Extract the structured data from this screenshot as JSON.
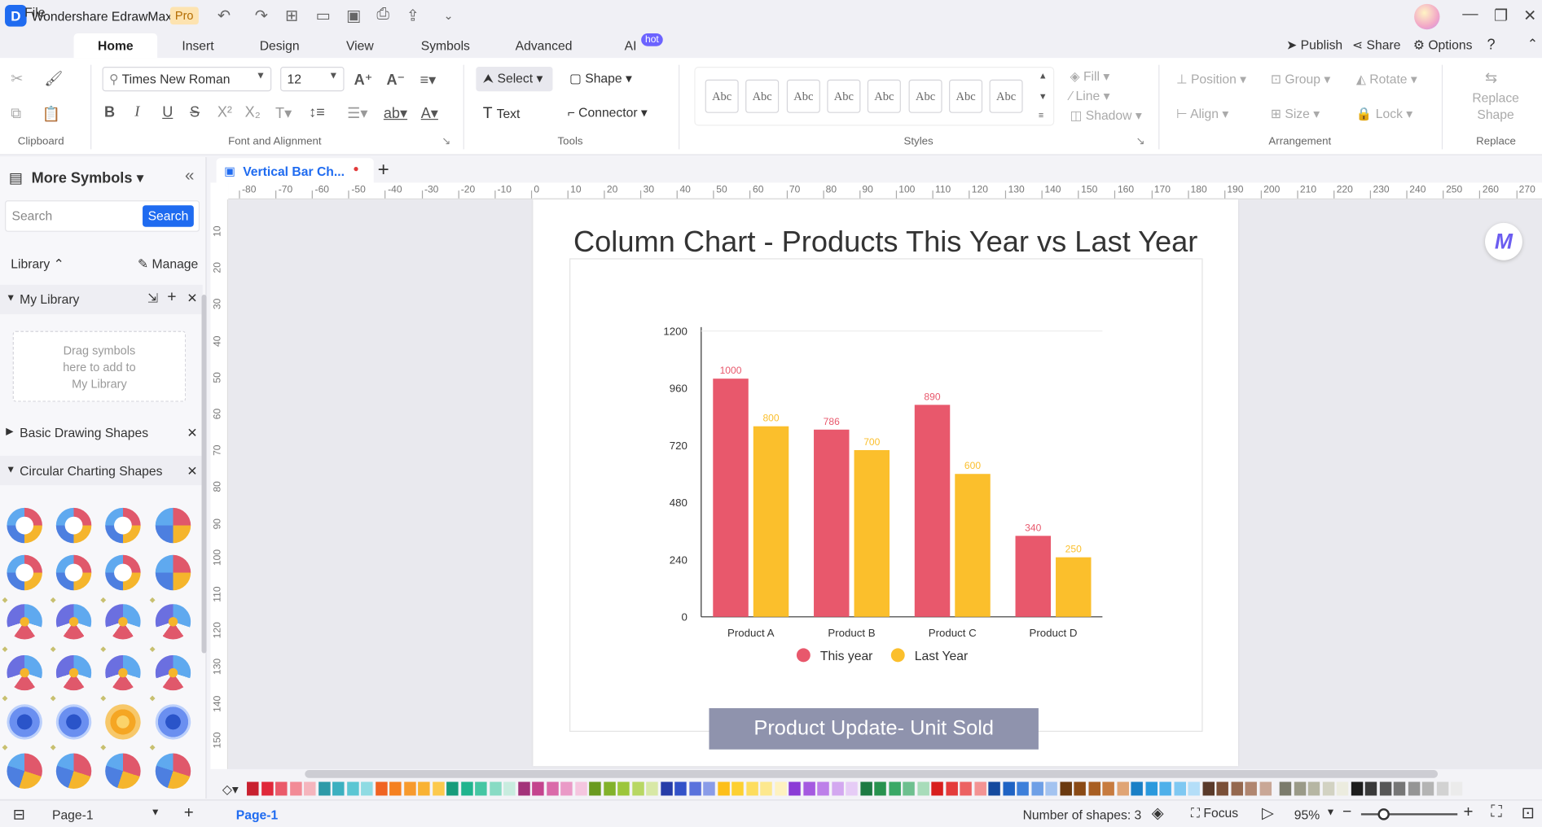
{
  "app": {
    "name": "Wondershare EdrawMax",
    "badge": "Pro",
    "logo": "D"
  },
  "menus": {
    "file": "File",
    "home": "Home",
    "insert": "Insert",
    "design": "Design",
    "view": "View",
    "symbols": "Symbols",
    "advanced": "Advanced",
    "ai": "AI",
    "ai_badge": "hot"
  },
  "actions": {
    "publish": "Publish",
    "share": "Share",
    "options": "Options"
  },
  "ribbon": {
    "font_name": "Times New Roman",
    "font_size": "12",
    "select": "Select",
    "shape": "Shape",
    "text": "Text",
    "connector": "Connector",
    "style_sample": "Abc",
    "fill": "Fill",
    "line": "Line",
    "shadow": "Shadow",
    "position": "Position",
    "group": "Group",
    "rotate": "Rotate",
    "align": "Align",
    "size": "Size",
    "lock": "Lock",
    "replace_shape_1": "Replace",
    "replace_shape_2": "Shape",
    "groups": {
      "clipboard": "Clipboard",
      "font": "Font and Alignment",
      "tools": "Tools",
      "styles": "Styles",
      "arrangement": "Arrangement",
      "replace": "Replace"
    }
  },
  "left_panel": {
    "title": "More Symbols",
    "search_placeholder": "Search",
    "search_button": "Search",
    "library": "Library",
    "manage": "Manage",
    "my_library": "My Library",
    "drag_hint_1": "Drag symbols",
    "drag_hint_2": "here to add to",
    "drag_hint_3": "My Library",
    "basic_shapes": "Basic Drawing Shapes",
    "circular_shapes": "Circular Charting Shapes"
  },
  "document": {
    "tab": "Vertical Bar Ch...",
    "page": "Page-1",
    "page_tab": "Page-1"
  },
  "ruler": {
    "h": [
      "-80",
      "-70",
      "-60",
      "-50",
      "-40",
      "-30",
      "-20",
      "-10",
      "0",
      "10",
      "20",
      "30",
      "40",
      "50",
      "60",
      "70",
      "80",
      "90",
      "100",
      "110",
      "120",
      "130",
      "140",
      "150",
      "160",
      "170",
      "180",
      "190",
      "200",
      "210",
      "220",
      "230",
      "240",
      "250",
      "260",
      "270"
    ],
    "v": [
      "10",
      "20",
      "30",
      "40",
      "50",
      "60",
      "70",
      "80",
      "90",
      "100",
      "110",
      "120",
      "130",
      "140",
      "150"
    ]
  },
  "canvas": {
    "chart_title": "Column Chart - Products This Year vs Last Year",
    "banner": "Product Update- Unit Sold",
    "badge_icon": "M"
  },
  "chart_data": {
    "type": "bar",
    "categories": [
      "Product A",
      "Product B",
      "Product C",
      "Product D"
    ],
    "series": [
      {
        "name": "This year",
        "values": [
          1000,
          786,
          890,
          340
        ],
        "color": "#e8586c"
      },
      {
        "name": "Last Year",
        "values": [
          800,
          700,
          600,
          250
        ],
        "color": "#fbbf2c"
      }
    ],
    "yticks": [
      "0",
      "240",
      "480",
      "720",
      "960",
      "1200"
    ],
    "ylim": [
      0,
      1200
    ],
    "legend": "bottom",
    "grid": false
  },
  "status": {
    "shapes": "Number of shapes: 3",
    "focus": "Focus",
    "zoom": "95%"
  },
  "palette": [
    "#c8202f",
    "#e0283a",
    "#ea5a6a",
    "#f28b96",
    "#f5b5bd",
    "#2e9aa8",
    "#3cb0c0",
    "#5cc6d3",
    "#8fdbe3",
    "#f06422",
    "#f58020",
    "#f79a2e",
    "#f9b233",
    "#fcc94d",
    "#179c7b",
    "#20b48e",
    "#45c6a3",
    "#88dbc4",
    "#c8ecdf",
    "#a3337a",
    "#c4448e",
    "#da6aa9",
    "#ea9ac7",
    "#f5c6df",
    "#6a9a20",
    "#82b22b",
    "#9cc63b",
    "#b8d764",
    "#d8e8a6",
    "#263ca8",
    "#3352c8",
    "#5a72dc",
    "#8a9ce8",
    "#fdbf1a",
    "#fdd031",
    "#fddd5e",
    "#fde88e",
    "#fef2c0",
    "#8b3cd6",
    "#a55ae0",
    "#bd80e9",
    "#d3a8f0",
    "#e6ccf6",
    "#1d7a43",
    "#28924f",
    "#3aa866",
    "#6ec08f",
    "#a8dcba",
    "#d81e1e",
    "#e43b3b",
    "#ec6262",
    "#f39393",
    "#154a9e",
    "#1f63c4",
    "#3d7fda",
    "#6e9fe6",
    "#a3c3f0",
    "#6b3a10",
    "#8a4a16",
    "#a85e22",
    "#c77b3f",
    "#e0a475",
    "#1a7fc6",
    "#2a99dd",
    "#4fb0ea",
    "#7fc8f2",
    "#b4def8",
    "#5a3a2a",
    "#7a5038",
    "#95684f",
    "#b08670",
    "#c9a796",
    "#7b7b6c",
    "#9a9a88",
    "#b6b6a3",
    "#d2d2c2",
    "#ececdf",
    "#1d1d1d",
    "#3a3a3a",
    "#575757",
    "#767676",
    "#959595",
    "#b4b4b4",
    "#d2d2d2",
    "#ebebeb"
  ]
}
